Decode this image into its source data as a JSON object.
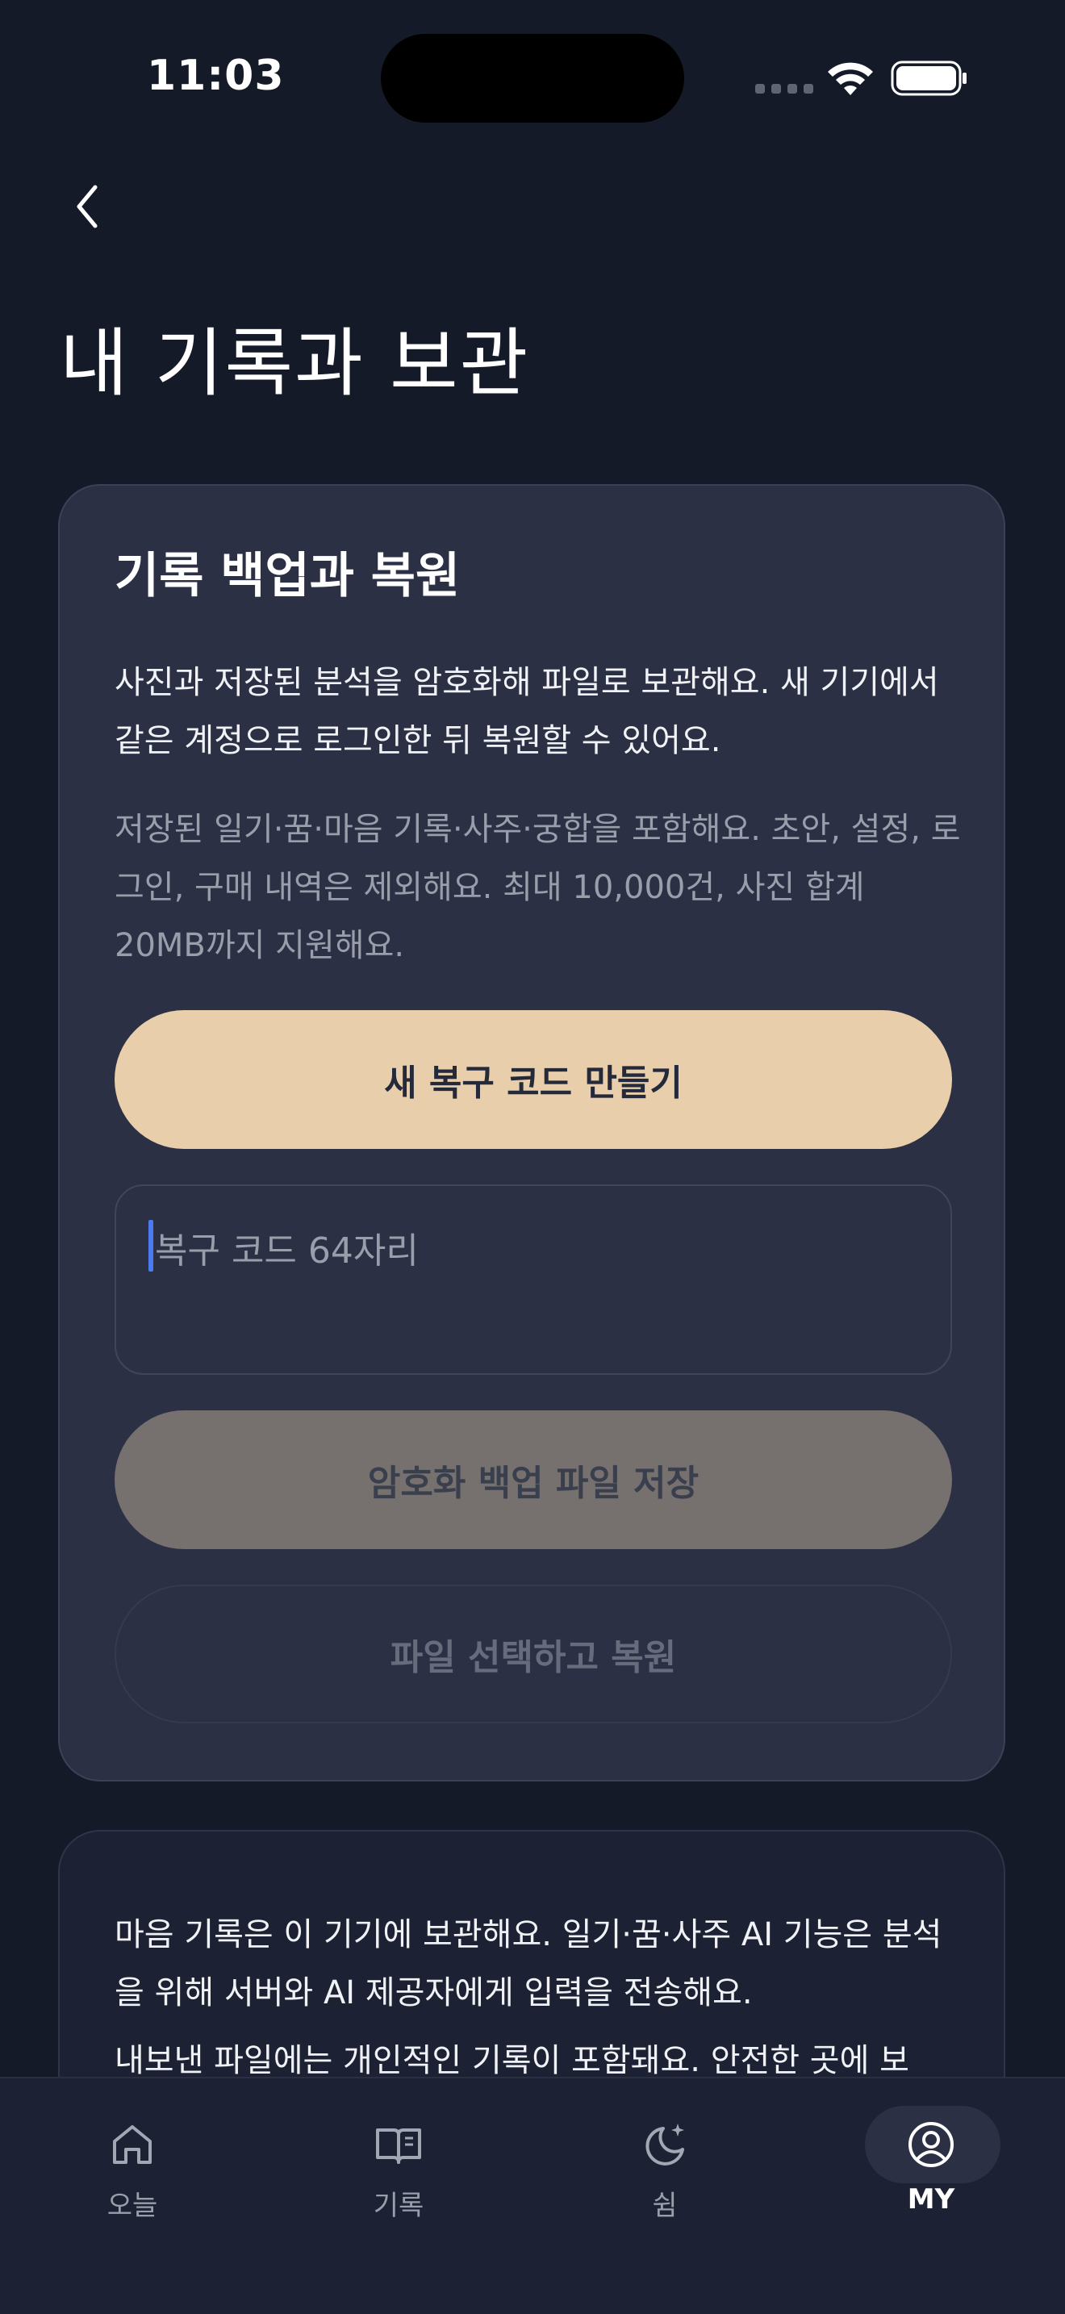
{
  "status_bar": {
    "time": "11:03"
  },
  "header": {
    "back_icon": "chevron-left-icon",
    "title": "내 기록과 보관"
  },
  "backup_card": {
    "heading": "기록 백업과 복원",
    "description": "사진과 저장된 분석을 암호화해 파일로 보관해요. 새 기기에서 같은 계정으로 로그인한 뒤 복원할 수 있어요.",
    "note": "저장된 일기·꿈·마음 기록·사주·궁합을 포함해요. 초안, 설정, 로그인, 구매 내역은 제외해요. 최대 10,000건, 사진 합계 20MB까지 지원해요.",
    "create_code_button": "새 복구 코드 만들기",
    "code_input": {
      "value": "",
      "placeholder": "복구 코드 64자리"
    },
    "save_button": "암호화 백업 파일 저장",
    "restore_button": "파일 선택하고 복원"
  },
  "info_card": {
    "text_1": "마음 기록은 이 기기에 보관해요. 일기·꿈·사주 AI 기능은 분석을 위해 서버와 AI 제공자에게 입력을 전송해요.",
    "text_2": "내보낸 파일에는 개인적인 기록이 포함돼요. 안전한 곳에 보"
  },
  "tab_bar": {
    "items": [
      {
        "label": "오늘",
        "icon": "home-icon",
        "active": false
      },
      {
        "label": "기록",
        "icon": "book-open-icon",
        "active": false
      },
      {
        "label": "쉼",
        "icon": "moon-sparkle-icon",
        "active": false
      },
      {
        "label": "MY",
        "icon": "user-circle-icon",
        "active": true
      }
    ]
  },
  "colors": {
    "background": "#141a27",
    "card": "#2b3045",
    "primary_button": "#e8ceab",
    "disabled_button": "#76706f",
    "caret": "#4a7bf0"
  }
}
